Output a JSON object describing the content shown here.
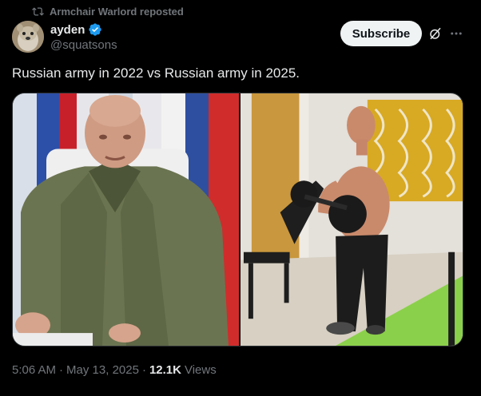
{
  "repost": {
    "text": "Armchair Warlord reposted",
    "icon": "repost-icon"
  },
  "author": {
    "name": "ayden",
    "handle": "@squatsons",
    "verified": true,
    "verified_color": "#1d9bf0"
  },
  "actions": {
    "subscribe_label": "Subscribe",
    "grok_icon": "grok-icon",
    "more_icon": "more-icon"
  },
  "post": {
    "text": "Russian army in 2022 vs Russian army in 2025."
  },
  "media": {
    "left_photo": "general-in-uniform-photo",
    "right_photo": "shirtless-man-gym-photo"
  },
  "meta": {
    "time": "5:06 AM",
    "sep1": "·",
    "date": "May 13, 2025",
    "sep2": "·",
    "views_count": "12.1K",
    "views_label": "Views"
  },
  "colors": {
    "background": "#000000",
    "text": "#e7e9ea",
    "muted": "#71767b",
    "button_bg": "#eff3f4"
  }
}
